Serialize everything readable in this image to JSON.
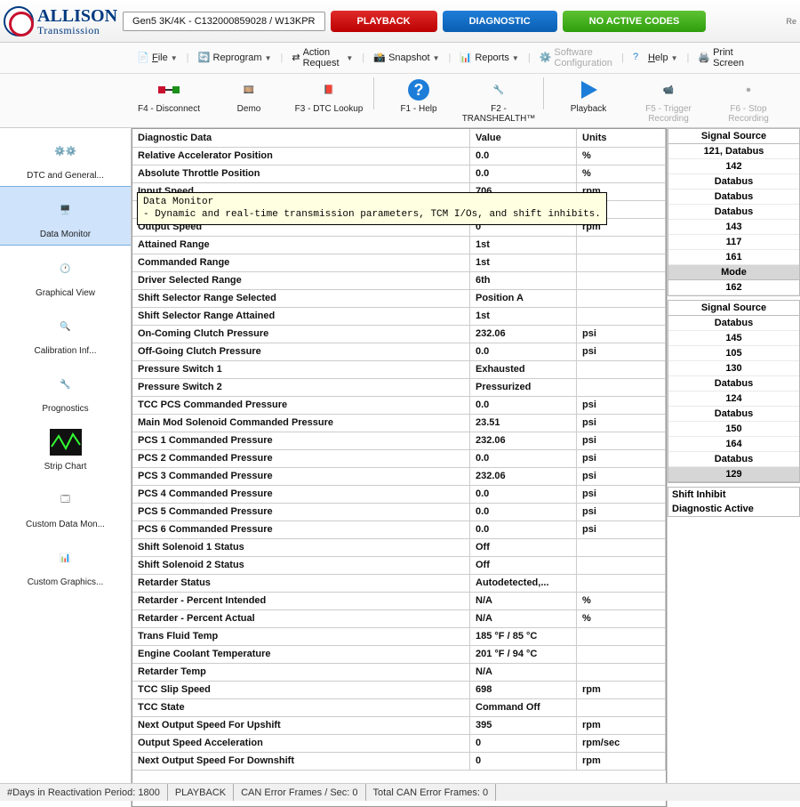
{
  "header": {
    "brand_line1": "ALLISON",
    "brand_line2": "Transmission",
    "session_title": "Gen5 3K/4K - C132000859028 / W13KPR",
    "chip_playback": "PLAYBACK",
    "chip_diagnostic": "DIAGNOSTIC",
    "chip_codes": "NO ACTIVE CODES",
    "re_label": "Re"
  },
  "menu": {
    "file": "File",
    "reprogram": "Reprogram",
    "action_request": "Action Request",
    "snapshot": "Snapshot",
    "reports": "Reports",
    "software_config": "Software Configuration",
    "help": "Help",
    "print_screen": "Print Screen"
  },
  "toolbar": {
    "disconnect": "F4 - Disconnect",
    "demo": "Demo",
    "dtc_lookup": "F3 - DTC Lookup",
    "help": "F1 - Help",
    "transhealth": "F2 - TRANSHEALTH™",
    "playback": "Playback",
    "trigger_rec": "F5 - Trigger Recording",
    "stop_rec": "F6 - Stop Recording"
  },
  "sidebar": {
    "items": [
      {
        "label": "DTC and General..."
      },
      {
        "label": "Data Monitor"
      },
      {
        "label": "Graphical View"
      },
      {
        "label": "Calibration Inf..."
      },
      {
        "label": "Prognostics"
      },
      {
        "label": "Strip Chart"
      },
      {
        "label": "Custom Data Mon..."
      },
      {
        "label": "Custom Graphics..."
      }
    ]
  },
  "tooltip": {
    "title": "Data Monitor",
    "body": "- Dynamic and real-time transmission parameters, TCM I/Os, and shift inhibits."
  },
  "table": {
    "col_diag": "Diagnostic Data",
    "col_value": "Value",
    "col_units": "Units",
    "rows": [
      {
        "d": "Relative Accelerator Position",
        "v": "0.0",
        "u": "%"
      },
      {
        "d": "Absolute Throttle Position",
        "v": "0.0",
        "u": "%"
      },
      {
        "d": "Input Speed",
        "v": "706",
        "u": "rpm"
      },
      {
        "d": "",
        "v": "",
        "u": "rpm"
      },
      {
        "d": "Output Speed",
        "v": "0",
        "u": "rpm"
      },
      {
        "d": "Attained Range",
        "v": "1st",
        "u": ""
      },
      {
        "d": "Commanded Range",
        "v": "1st",
        "u": ""
      },
      {
        "d": "Driver Selected Range",
        "v": "6th",
        "u": ""
      },
      {
        "d": "Shift Selector Range Selected",
        "v": "Position A",
        "u": ""
      },
      {
        "d": "Shift Selector Range Attained",
        "v": "1st",
        "u": ""
      },
      {
        "d": "On-Coming Clutch Pressure",
        "v": "232.06",
        "u": "psi"
      },
      {
        "d": "Off-Going Clutch Pressure",
        "v": "0.0",
        "u": "psi"
      },
      {
        "d": "Pressure Switch 1",
        "v": "Exhausted",
        "u": ""
      },
      {
        "d": "Pressure Switch 2",
        "v": "Pressurized",
        "u": ""
      },
      {
        "d": "TCC PCS Commanded Pressure",
        "v": "0.0",
        "u": "psi"
      },
      {
        "d": "Main Mod Solenoid Commanded Pressure",
        "v": "23.51",
        "u": "psi"
      },
      {
        "d": "PCS 1 Commanded Pressure",
        "v": "232.06",
        "u": "psi"
      },
      {
        "d": "PCS 2 Commanded Pressure",
        "v": "0.0",
        "u": "psi"
      },
      {
        "d": "PCS 3 Commanded Pressure",
        "v": "232.06",
        "u": "psi"
      },
      {
        "d": "PCS 4 Commanded Pressure",
        "v": "0.0",
        "u": "psi"
      },
      {
        "d": "PCS 5 Commanded Pressure",
        "v": "0.0",
        "u": "psi"
      },
      {
        "d": "PCS 6 Commanded Pressure",
        "v": "0.0",
        "u": "psi"
      },
      {
        "d": "Shift Solenoid 1 Status",
        "v": "Off",
        "u": ""
      },
      {
        "d": "Shift Solenoid 2 Status",
        "v": "Off",
        "u": ""
      },
      {
        "d": "Retarder Status",
        "v": "Autodetected,...",
        "u": ""
      },
      {
        "d": "Retarder - Percent Intended",
        "v": "N/A",
        "u": "%"
      },
      {
        "d": "Retarder - Percent Actual",
        "v": "N/A",
        "u": "%"
      },
      {
        "d": "Trans Fluid Temp",
        "v": "185 °F /  85  °C",
        "u": ""
      },
      {
        "d": "Engine Coolant Temperature",
        "v": "201 °F /  94  °C",
        "u": ""
      },
      {
        "d": "Retarder Temp",
        "v": "N/A",
        "u": ""
      },
      {
        "d": "TCC Slip Speed",
        "v": "698",
        "u": "rpm"
      },
      {
        "d": "TCC State",
        "v": "Command Off",
        "u": ""
      },
      {
        "d": "Next Output Speed For Upshift",
        "v": "395",
        "u": "rpm"
      },
      {
        "d": "Output Speed Acceleration",
        "v": "0",
        "u": "rpm/sec"
      },
      {
        "d": "Next Output Speed For Downshift",
        "v": "0",
        "u": "rpm"
      }
    ]
  },
  "rpanel1": {
    "head": "Signal Source",
    "rows": [
      "121, Databus",
      "142",
      "Databus",
      "Databus",
      "Databus",
      "143",
      "117",
      "161"
    ],
    "hl": "Mode",
    "rows2": [
      "162"
    ]
  },
  "rpanel2": {
    "head": "Signal Source",
    "rows": [
      "Databus",
      "145",
      "105",
      "130",
      "Databus",
      "124",
      "Databus",
      "150",
      "164",
      "Databus"
    ],
    "hl": "129"
  },
  "rpanel3": {
    "rows": [
      "Shift Inhibit",
      "Diagnostic Active"
    ]
  },
  "status": {
    "s1": "#Days in Reactivation Period: 1800",
    "s2": "PLAYBACK",
    "s3": "CAN Error Frames / Sec:  0",
    "s4": "Total CAN Error Frames:  0"
  }
}
